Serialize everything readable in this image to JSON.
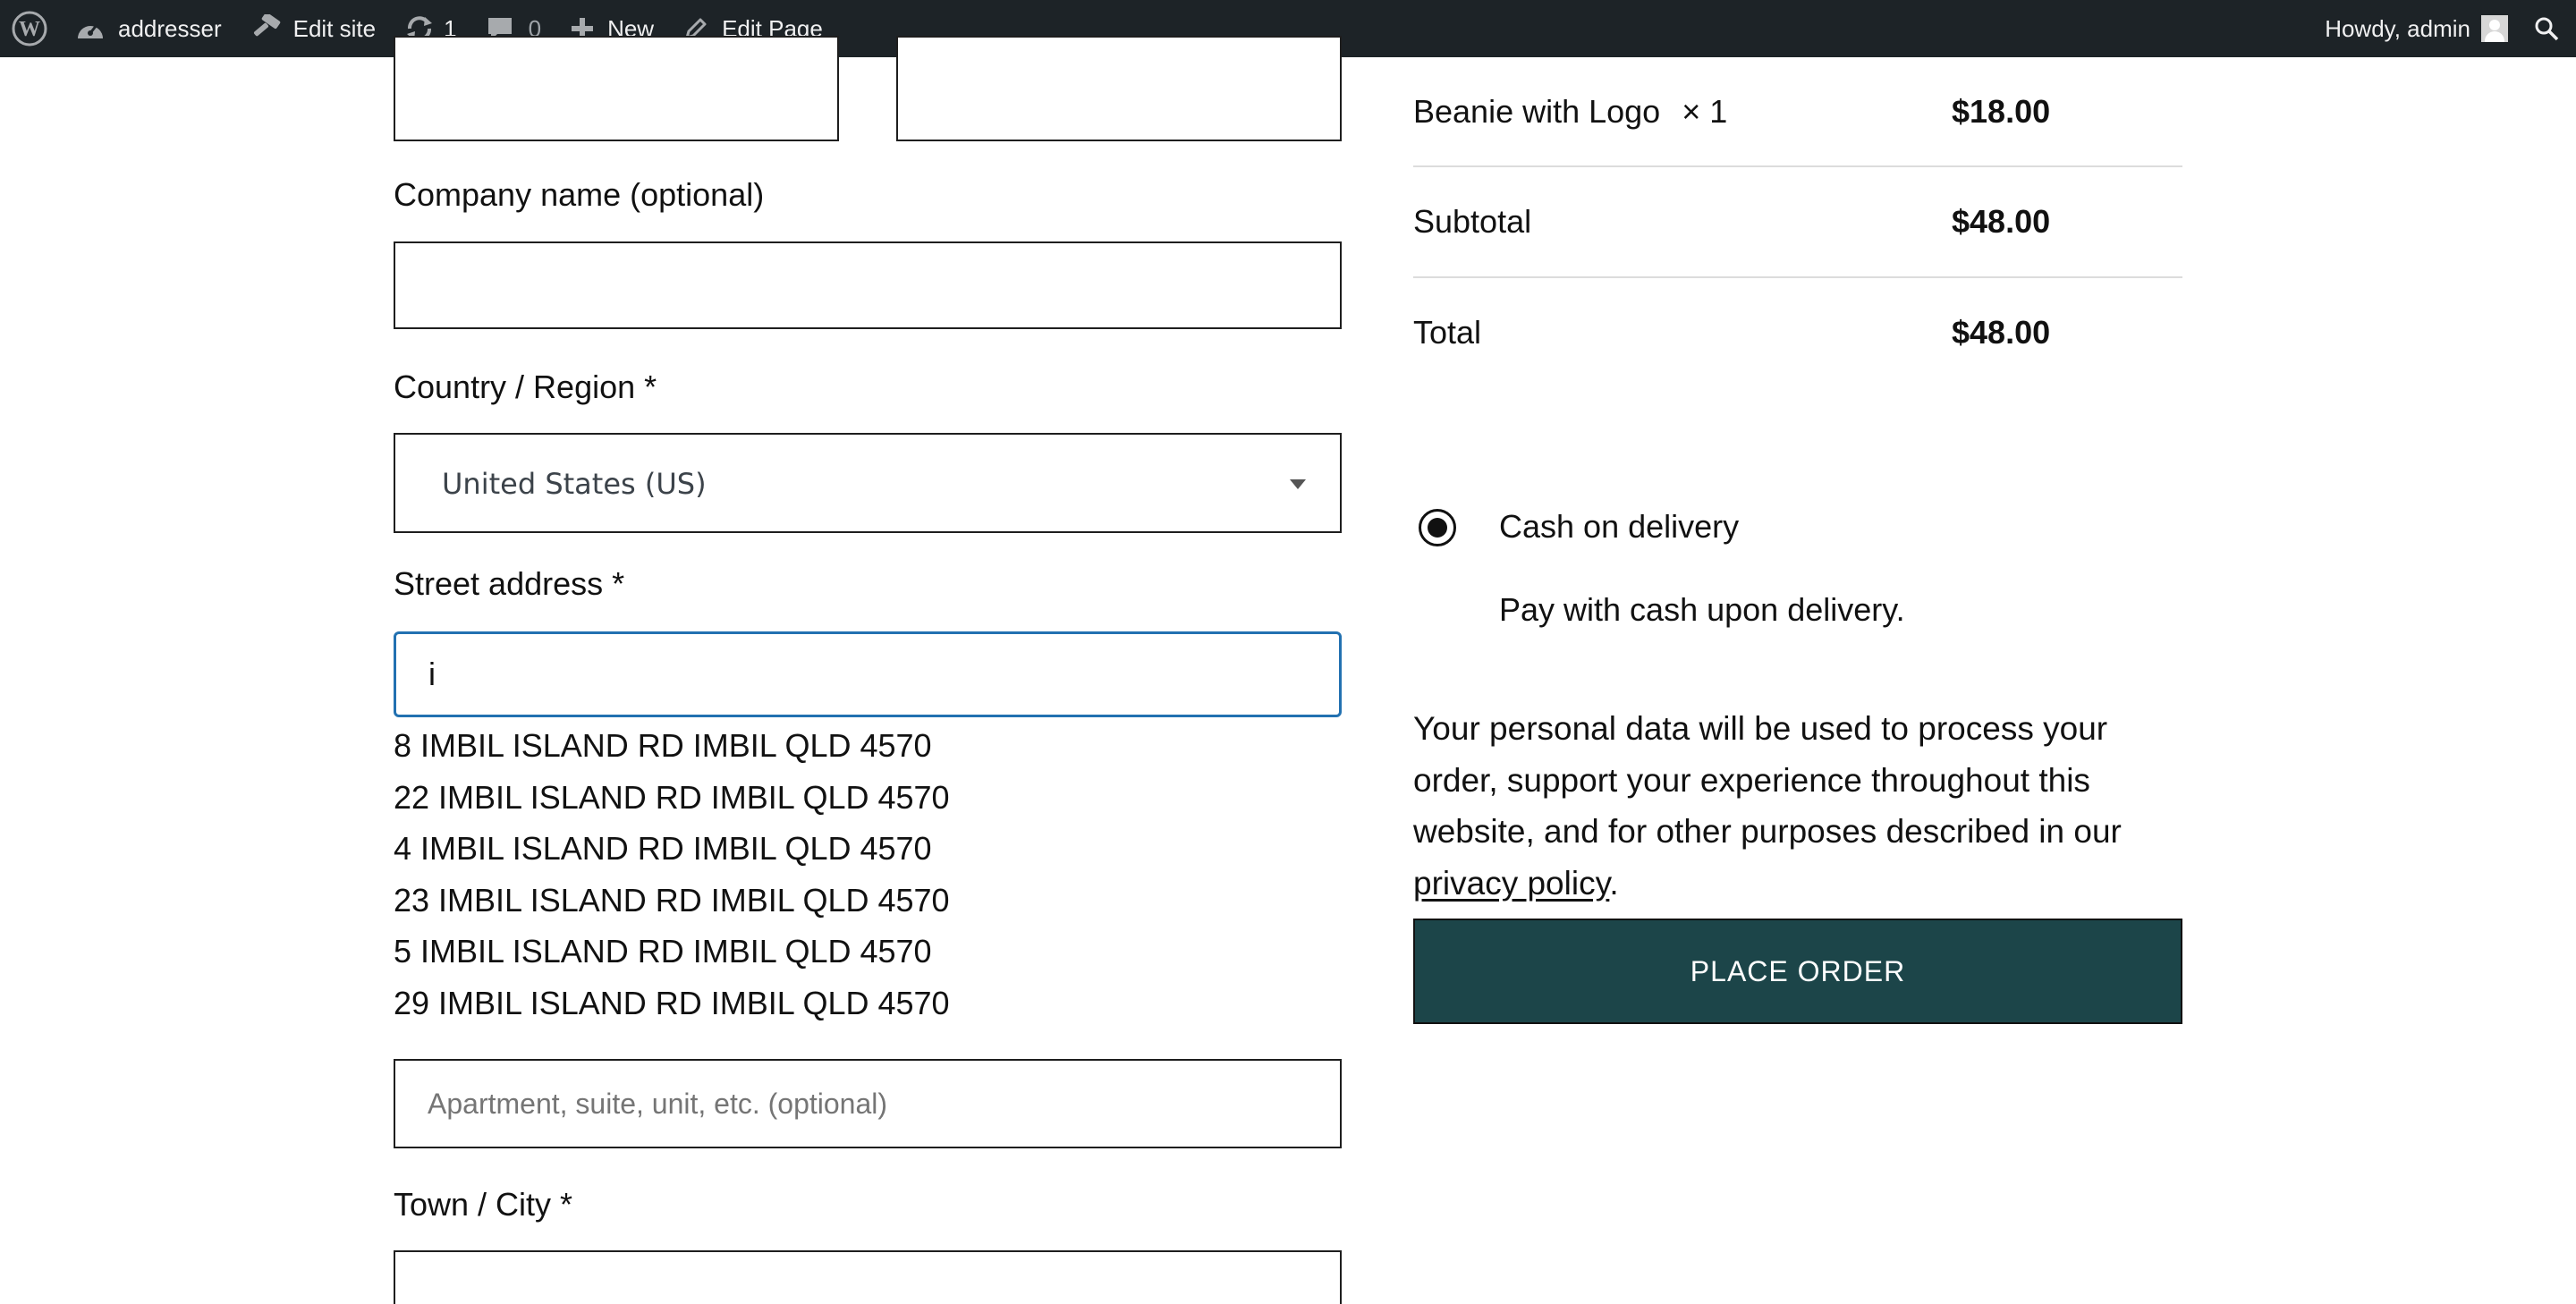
{
  "admin_bar": {
    "site_name": "addresser",
    "edit_site": "Edit site",
    "updates_count": "1",
    "comments_count": "0",
    "new_label": "New",
    "edit_page": "Edit Page",
    "greeting": "Howdy, admin",
    "icons": {
      "wp_logo": "wordpress-logo-icon",
      "site": "dashboard-icon",
      "edit_site": "hammer-icon",
      "updates": "refresh-icon",
      "comments": "comment-icon",
      "new": "plus-icon",
      "edit_page": "pencil-icon",
      "search": "search-icon"
    }
  },
  "form": {
    "company_label": "Company name (optional)",
    "country_label": "Country / Region *",
    "country_value": "United States (US)",
    "street_label": "Street address *",
    "street_value": "i",
    "address_suggestions": [
      "8 IMBIL ISLAND RD IMBIL QLD 4570",
      "22 IMBIL ISLAND RD IMBIL QLD 4570",
      "4 IMBIL ISLAND RD IMBIL QLD 4570",
      "23 IMBIL ISLAND RD IMBIL QLD 4570",
      "5 IMBIL ISLAND RD IMBIL QLD 4570",
      "29 IMBIL ISLAND RD IMBIL QLD 4570"
    ],
    "apartment_placeholder": "Apartment, suite, unit, etc. (optional)",
    "city_label": "Town / City *"
  },
  "order_summary": {
    "item_name": "Beanie with Logo",
    "item_qty": "× 1",
    "item_price": "$18.00",
    "subtotal_label": "Subtotal",
    "subtotal_value": "$48.00",
    "total_label": "Total",
    "total_value": "$48.00"
  },
  "payment": {
    "method_label": "Cash on delivery",
    "method_selected": true,
    "method_description": "Pay with cash upon delivery."
  },
  "privacy": {
    "text_before": "Your personal data will be used to process your order, support your experience throughout this website, and for other purposes described in our ",
    "link_text": "privacy policy",
    "text_after": "."
  },
  "place_order_label": "PLACE ORDER",
  "colors": {
    "admin_bar_bg": "#1d2327",
    "focus_border": "#2271b1",
    "place_order_bg": "#1c4549"
  }
}
